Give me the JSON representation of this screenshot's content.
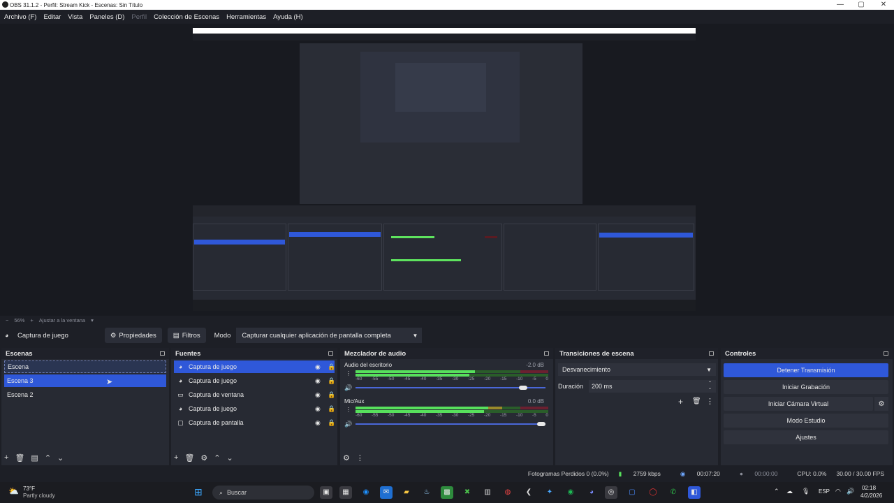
{
  "window": {
    "title": "OBS 31.1.2 - Perfil: Stream Kick - Escenas: Sin Título"
  },
  "menu": [
    "Archivo (F)",
    "Editar",
    "Vista",
    "Paneles (D)",
    "Perfil",
    "Colección de Escenas",
    "Herramientas",
    "Ayuda (H)"
  ],
  "zoom": {
    "minus": "−",
    "value": "56%",
    "plus": "+",
    "fit": "Ajustar a la ventana"
  },
  "source_toolbar": {
    "source_name": "Captura de juego",
    "properties": "Propiedades",
    "filters": "Filtros",
    "mode_label": "Modo",
    "mode_value": "Capturar cualquier aplicación de pantalla completa"
  },
  "scenes": {
    "title": "Escenas",
    "items": [
      "Escena",
      "Escena 3",
      "Escena 2"
    ]
  },
  "sources": {
    "title": "Fuentes",
    "items": [
      {
        "label": "Captura de juego",
        "icon": "gamepad-icon"
      },
      {
        "label": "Captura de juego",
        "icon": "gamepad-icon"
      },
      {
        "label": "Captura de ventana",
        "icon": "window-icon"
      },
      {
        "label": "Captura de juego",
        "icon": "gamepad-icon"
      },
      {
        "label": "Captura de pantalla",
        "icon": "monitor-icon"
      }
    ]
  },
  "mixer": {
    "title": "Mezclador de audio",
    "channels": [
      {
        "name": "Audio del escritorio",
        "db": "-2.0 dB",
        "level": 0.62,
        "volume": 0.9
      },
      {
        "name": "Mic/Aux",
        "db": "0.0 dB",
        "level": 0.7,
        "volume": 1.0
      }
    ],
    "scale": [
      "-60",
      "-55",
      "-50",
      "-45",
      "-40",
      "-35",
      "-30",
      "-25",
      "-20",
      "-15",
      "-10",
      "-5",
      "0"
    ]
  },
  "transitions": {
    "title": "Transiciones de escena",
    "selected": "Desvanecimiento",
    "duration_label": "Duración",
    "duration_value": "200 ms"
  },
  "controls": {
    "title": "Controles",
    "buttons": [
      "Detener Transmisión",
      "Iniciar Grabación",
      "Iniciar Cámara Virtual",
      "Modo Estudio",
      "Ajustes"
    ]
  },
  "status": {
    "dropped": "Fotogramas Perdidos 0 (0.0%)",
    "bitrate": "2759 kbps",
    "stream_time": "00:07:20",
    "rec_time": "00:00:00",
    "cpu": "CPU: 0.0%",
    "fps": "30.00 / 30.00 FPS"
  },
  "taskbar": {
    "weather_temp": "73°F",
    "weather_desc": "Partly cloudy",
    "search": "Buscar",
    "lang": "ESP",
    "time": "02:18",
    "date": "4/2/2026"
  },
  "colors": {
    "accent": "#2f58d9",
    "panel": "#272a33",
    "bg": "#1d1f26"
  }
}
